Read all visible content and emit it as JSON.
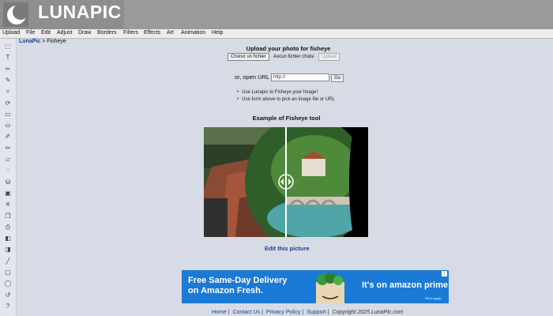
{
  "app": {
    "logo_text": "LUNAPIC"
  },
  "menu": [
    "Upload",
    "File",
    "Edit",
    "Adjust",
    "Draw",
    "Borders",
    "Filters",
    "Effects",
    "Art",
    "Animation",
    "Help"
  ],
  "breadcrumb": {
    "home": "LunaPic",
    "separator": ">",
    "current": "Fisheye"
  },
  "upload": {
    "title": "Upload your photo for fisheye",
    "choose_button": "Choisir un fichier",
    "file_status": "Aucun fichier choisi",
    "upload_button": "Upload"
  },
  "url": {
    "label": "or, open URL",
    "value": "http://",
    "go_button": "Go"
  },
  "tips": [
    "Use Lunapic to Fisheye your Image!",
    "Use form above to pick an image file or URL"
  ],
  "example": {
    "title": "Example of Fisheye tool",
    "edit_link": "Edit this picture"
  },
  "ad": {
    "headline": "Free Same-Day Delivery",
    "subline": "on Amazon Fresh.",
    "cta": "It's on amazon prime",
    "small": "T&Cs apply",
    "brand_color": "#1b7ad6"
  },
  "footer": {
    "links": [
      "Home",
      "Contact Us",
      "Privacy Policy",
      "Support"
    ],
    "copyright": "Copyright 2025 LunaPic.com"
  },
  "toolbar_icons": [
    "select-icon",
    "text-icon",
    "scissors-icon",
    "brush-icon",
    "zoom-icon",
    "rotate-icon",
    "crop-icon",
    "paint-bucket-icon",
    "eyedropper-icon",
    "pencil-icon",
    "eraser-icon",
    "spray-icon",
    "bucket-icon",
    "save-icon",
    "cut-icon",
    "copy-icon",
    "print-icon",
    "layers-icon",
    "stack-icon",
    "line-icon",
    "rectangle-icon",
    "ellipse-icon",
    "undo-icon",
    "help-icon"
  ],
  "toolbar_glyphs": [
    "⬚",
    "T",
    "✂",
    "✎",
    "⌕",
    "⟳",
    "▭",
    "⛀",
    "✐",
    "✏",
    "▱",
    "◌",
    "⛁",
    "▣",
    "✕",
    "❐",
    "⎙",
    "◧",
    "◨",
    "╱",
    "▢",
    "◯",
    "↺",
    "?"
  ]
}
